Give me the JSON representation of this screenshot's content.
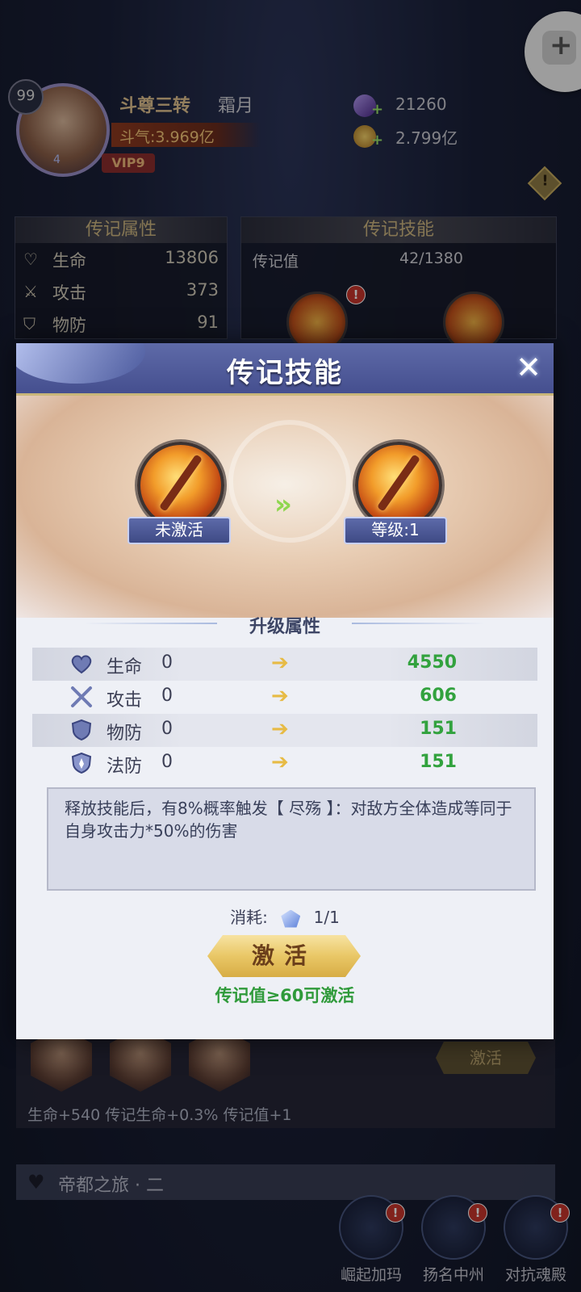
{
  "player": {
    "level": "99",
    "avatar_number": "4",
    "rank": "斗尊三转",
    "name": "霜月",
    "power": "斗气:3.969亿",
    "vip": "VIP9",
    "currency1": "21260",
    "currency2": "2.799亿"
  },
  "bg_panels": {
    "attr_title": "传记属性",
    "skill_title": "传记技能",
    "attrs": [
      {
        "name": "生命",
        "value": "13806"
      },
      {
        "name": "攻击",
        "value": "373"
      },
      {
        "name": "物防",
        "value": "91"
      }
    ],
    "biography_label": "传记值",
    "biography_value": "42/1380",
    "badge": "!"
  },
  "modal": {
    "title": "传记技能",
    "close": "✕",
    "before_label": "未激活",
    "after_label": "等级:1",
    "arrows": "»",
    "section_title": "升级属性",
    "stats": [
      {
        "name": "生命",
        "old": "0",
        "new": "4550"
      },
      {
        "name": "攻击",
        "old": "0",
        "new": "606"
      },
      {
        "name": "物防",
        "old": "0",
        "new": "151"
      },
      {
        "name": "法防",
        "old": "0",
        "new": "151"
      }
    ],
    "description": "释放技能后，有8%概率触发【 尽殇 】：对敌方全体造成等同于自身攻击力*50%的伤害",
    "cost_label": "消耗:",
    "cost_value": "1/1",
    "activate_button": "激活",
    "hint": "传记值≥60可激活"
  },
  "lower": {
    "activate_button": "激活",
    "bonus": "生命+540  传记生命+0.3%  传记值+1",
    "journey": "帝都之旅 · 二",
    "nav": [
      "崛起加玛",
      "扬名中州",
      "对抗魂殿"
    ],
    "badge": "!"
  },
  "colors": {
    "modal_header": "#454f8f",
    "gain_green": "#32a23e",
    "gold": "#e9c766"
  }
}
